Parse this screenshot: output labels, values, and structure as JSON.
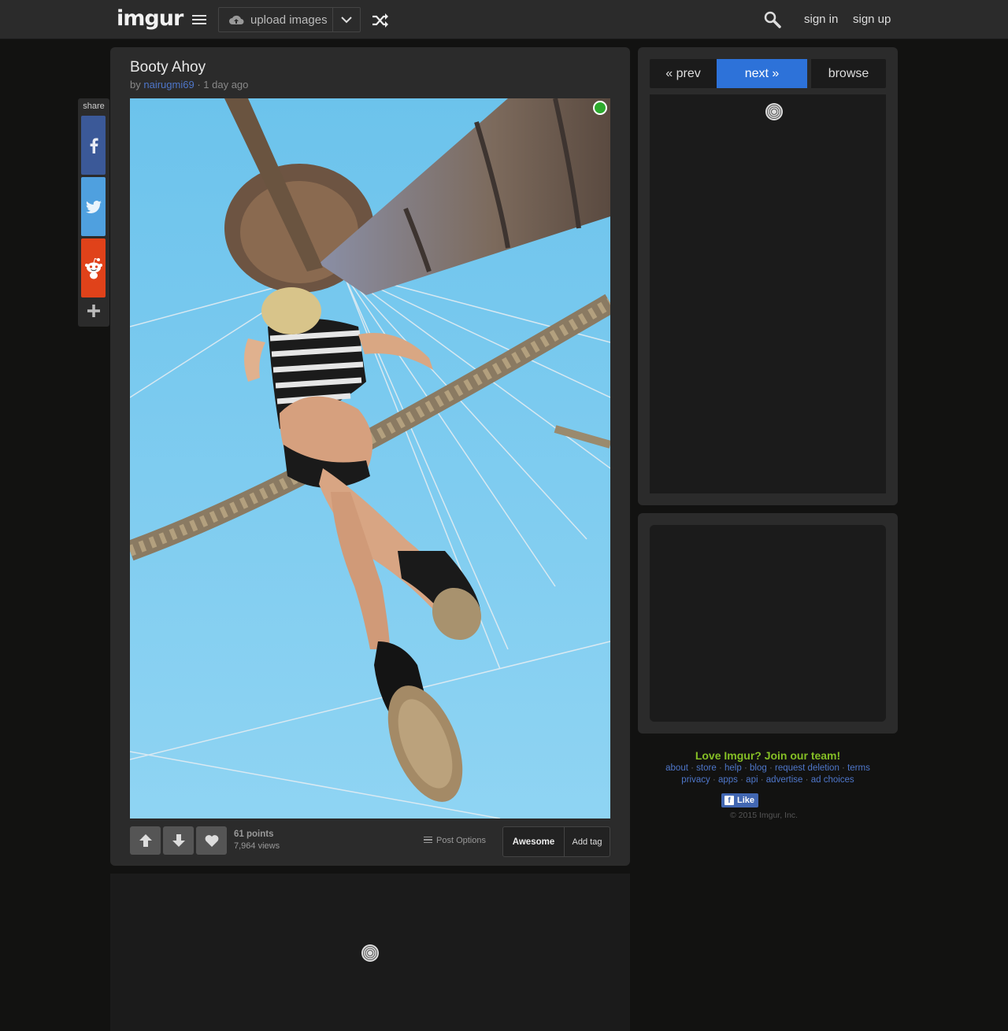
{
  "header": {
    "logo": "imgur",
    "upload_label": "upload images",
    "sign_in": "sign in",
    "sign_up": "sign up"
  },
  "share": {
    "label": "share",
    "buttons": [
      "facebook-icon",
      "twitter-icon",
      "reddit-icon",
      "plus-icon"
    ]
  },
  "post": {
    "title": "Booty Ahoy",
    "by": "by",
    "author": "nairugmi69",
    "separator": "·",
    "age": "1 day ago",
    "points": "61 points",
    "views": "7,964 views",
    "post_options": "Post Options",
    "tag": "Awesome",
    "add_tag": "Add tag"
  },
  "nav": {
    "prev": "« prev",
    "next": "next »",
    "browse": "browse"
  },
  "footer": {
    "join": "Love Imgur? Join our team!",
    "links_row1": [
      "about",
      "store",
      "help",
      "blog",
      "request deletion",
      "terms"
    ],
    "links_row2": [
      "privacy",
      "apps",
      "api",
      "advertise",
      "ad choices"
    ],
    "like": "Like",
    "copyright": "© 2015 Imgur, Inc."
  },
  "colors": {
    "accent": "#2d72d9",
    "brand_green": "#85bf25",
    "link": "#4e76c9",
    "panel": "#2b2b2b",
    "background": "#121211"
  }
}
